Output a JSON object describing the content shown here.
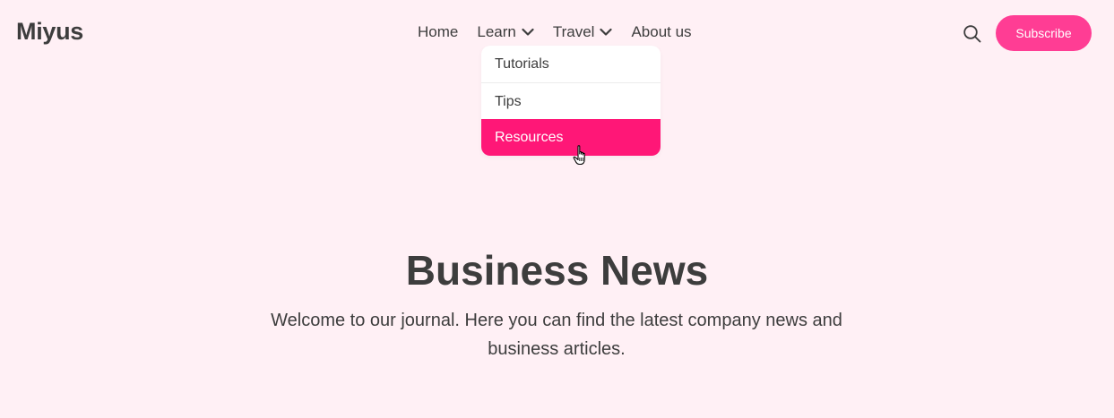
{
  "brand": {
    "name": "Miyus"
  },
  "nav": {
    "items": [
      {
        "label": "Home",
        "has_dropdown": false
      },
      {
        "label": "Learn",
        "has_dropdown": true
      },
      {
        "label": "Travel",
        "has_dropdown": true
      },
      {
        "label": "About us",
        "has_dropdown": false
      }
    ]
  },
  "dropdown": {
    "items": [
      {
        "label": "Tutorials",
        "active": false
      },
      {
        "label": "Tips",
        "active": false
      },
      {
        "label": "Resources",
        "active": true
      }
    ]
  },
  "header_actions": {
    "search_icon": "search-icon",
    "subscribe_label": "Subscribe"
  },
  "hero": {
    "title": "Business News",
    "subtitle": "Welcome to our journal. Here you can find the latest company news and business articles."
  },
  "colors": {
    "background": "#fff0f5",
    "text": "#3d3d3d",
    "accent": "#ff3d94",
    "active_item": "#ff1777"
  }
}
